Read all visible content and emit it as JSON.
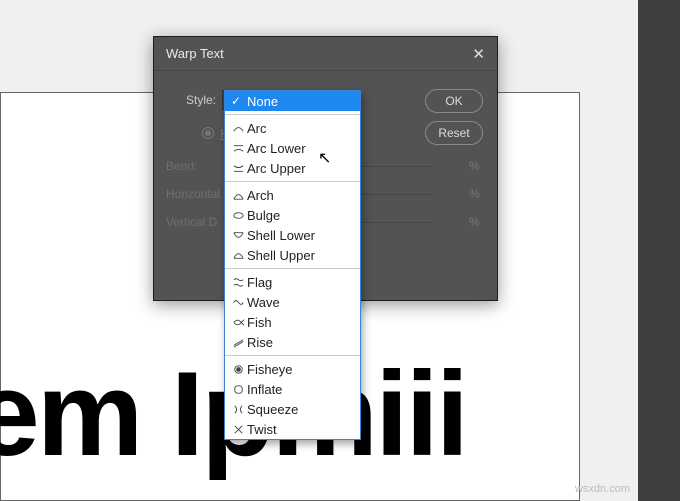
{
  "dialog": {
    "title": "Warp Text",
    "style_label": "Style:",
    "selected_style": "None",
    "orientation": {
      "horizontal_label": "H",
      "horizontal_selected": true
    },
    "sliders": {
      "bend_label": "Bend:",
      "bend_value": "",
      "horiz_label": "Horizontal",
      "horiz_value": "",
      "vert_label": "Vertical D",
      "vert_value": "",
      "pct": "%"
    },
    "buttons": {
      "ok": "OK",
      "reset": "Reset"
    }
  },
  "dropdown": {
    "groups": [
      {
        "items": [
          {
            "label": "None",
            "icon": "none",
            "selected": true
          }
        ]
      },
      {
        "items": [
          {
            "label": "Arc",
            "icon": "arc"
          },
          {
            "label": "Arc Lower",
            "icon": "arc-lower"
          },
          {
            "label": "Arc Upper",
            "icon": "arc-upper"
          }
        ]
      },
      {
        "items": [
          {
            "label": "Arch",
            "icon": "arch"
          },
          {
            "label": "Bulge",
            "icon": "bulge"
          },
          {
            "label": "Shell Lower",
            "icon": "shell-lower"
          },
          {
            "label": "Shell Upper",
            "icon": "shell-upper"
          }
        ]
      },
      {
        "items": [
          {
            "label": "Flag",
            "icon": "flag"
          },
          {
            "label": "Wave",
            "icon": "wave"
          },
          {
            "label": "Fish",
            "icon": "fish"
          },
          {
            "label": "Rise",
            "icon": "rise"
          }
        ]
      },
      {
        "items": [
          {
            "label": "Fisheye",
            "icon": "fisheye"
          },
          {
            "label": "Inflate",
            "icon": "inflate"
          },
          {
            "label": "Squeeze",
            "icon": "squeeze"
          },
          {
            "label": "Twist",
            "icon": "twist"
          }
        ]
      }
    ]
  },
  "background_text": "em Ipmiii",
  "watermark": "wsxdn.com"
}
